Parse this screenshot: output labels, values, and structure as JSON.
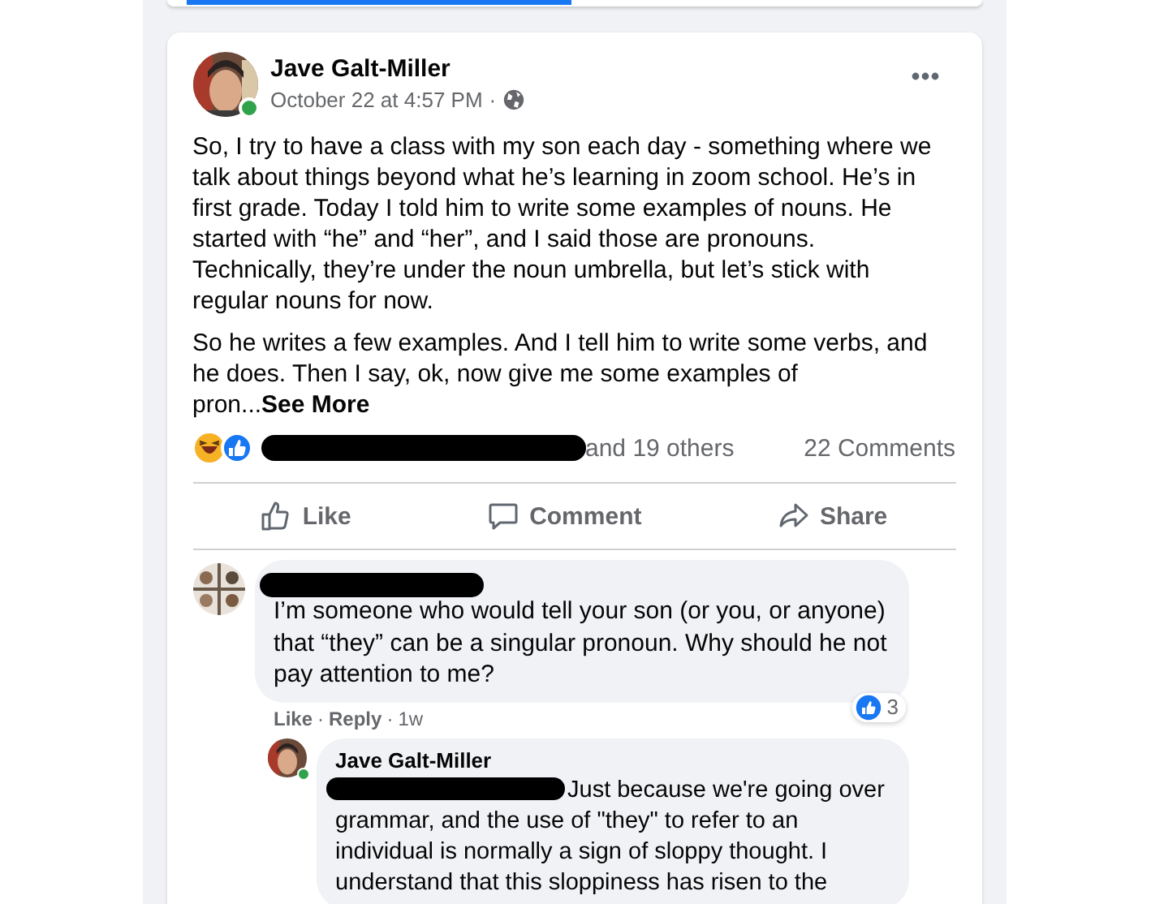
{
  "top_card": {
    "tabs": [
      {
        "selected": true
      },
      {
        "selected": false
      }
    ]
  },
  "post": {
    "author": "Jave Galt-Miller",
    "online": true,
    "time": "October 22 at 4:57 PM",
    "separator": "·",
    "paragraphs": [
      "So, I try to have a class with my son each day - something where we talk about things beyond what he’s learning in zoom school. He’s in first grade. Today I told him to write some examples of nouns. He started with “he” and “her”, and I said those are pronouns. Technically, they’re under the noun umbrella, but let’s stick with regular nouns for now.",
      "So he writes a few examples. And I tell him to write some verbs, and he does. Then I say, ok, now give me some examples of pron..."
    ],
    "see_more": "See More",
    "reactions_text": "and 19 others",
    "comments_count": "22 Comments",
    "actions": [
      {
        "kind": "like",
        "label": "Like"
      },
      {
        "kind": "comment",
        "label": "Comment"
      },
      {
        "kind": "share",
        "label": "Share"
      }
    ]
  },
  "comment": {
    "text": "I’m someone who would tell your son (or you, or anyone) that “they” can be a singular pronoun. Why should he not pay attention to me?",
    "links": [
      {
        "label": "Like",
        "separator": "·"
      },
      {
        "label": "Reply",
        "separator": "·"
      }
    ],
    "age": "1w",
    "reaction_count": "3"
  },
  "reply": {
    "author": "Jave Galt-Miller",
    "online": true,
    "text": "Just because we're going over grammar, and the use of \"they\" to refer to an individual is normally a sign of sloppy thought. I understand that this sloppiness has risen to the"
  }
}
